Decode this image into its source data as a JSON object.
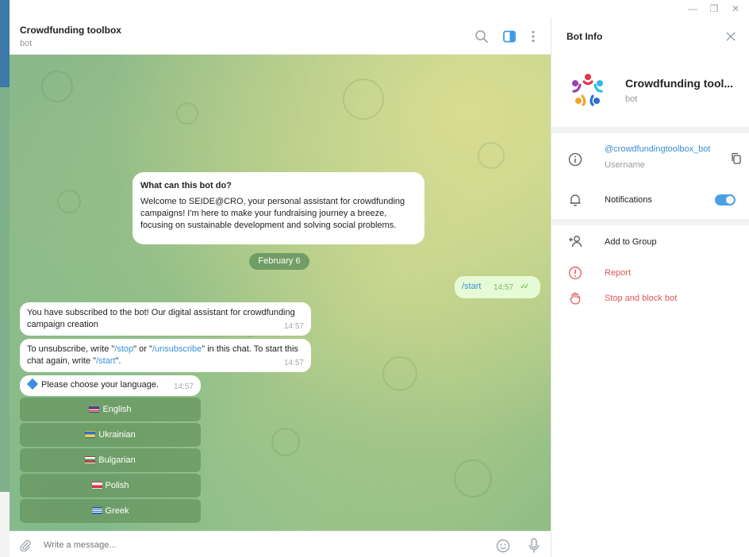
{
  "window": {
    "minimize_glyph": "—",
    "restore_glyph": "❐",
    "close_glyph": "✕"
  },
  "header": {
    "title": "Crowdfunding toolbox",
    "subtitle": "bot",
    "icons": [
      "search-icon",
      "sidebar-toggle-icon",
      "more-vertical-icon"
    ]
  },
  "chat": {
    "info": {
      "heading": "What can this bot do?",
      "body": "Welcome to SEIDE@CRO, your personal assistant for crowdfunding campaigns! I'm here to make your fundraising journey a breeze, focusing on sustainable development and solving social problems."
    },
    "date_label": "February 6",
    "outgoing": {
      "text": "/start",
      "time": "14:57",
      "status": "✓✓"
    },
    "incoming": [
      {
        "text": "You have subscribed to the bot! Our digital assistant for crowdfunding campaign creation",
        "time": "14:57"
      },
      {
        "parts": [
          "To unsubscribe, write \"",
          "/stop",
          "\" or \"",
          "/unsubscribe",
          "\" in this chat. To start this chat again, write \"",
          "/start",
          "\"."
        ],
        "time": "14:57"
      },
      {
        "text": "Please choose your language.",
        "time": "14:57"
      }
    ],
    "keyboard": [
      {
        "label": "English",
        "flag": "us"
      },
      {
        "label": "Ukrainian",
        "flag": "ua"
      },
      {
        "label": "Bulgarian",
        "flag": "bg"
      },
      {
        "label": "Polish",
        "flag": "pl"
      },
      {
        "label": "Greek",
        "flag": "gr"
      }
    ]
  },
  "input": {
    "placeholder": "Write a message..."
  },
  "panel": {
    "title": "Bot Info",
    "bot_name": "Crowdfunding tool...",
    "bot_sub": "bot",
    "username": "@crowdfundingtoolbox_bot",
    "username_label": "Username",
    "notifications_label": "Notifications",
    "notifications_on": true,
    "actions": {
      "add_to_group": "Add to Group",
      "report": "Report",
      "block": "Stop and block bot"
    }
  },
  "colors": {
    "accent": "#4ba0e3",
    "link": "#3a8fd6",
    "danger": "#e05656",
    "outgoing_bubble": "#e6fbd5"
  }
}
